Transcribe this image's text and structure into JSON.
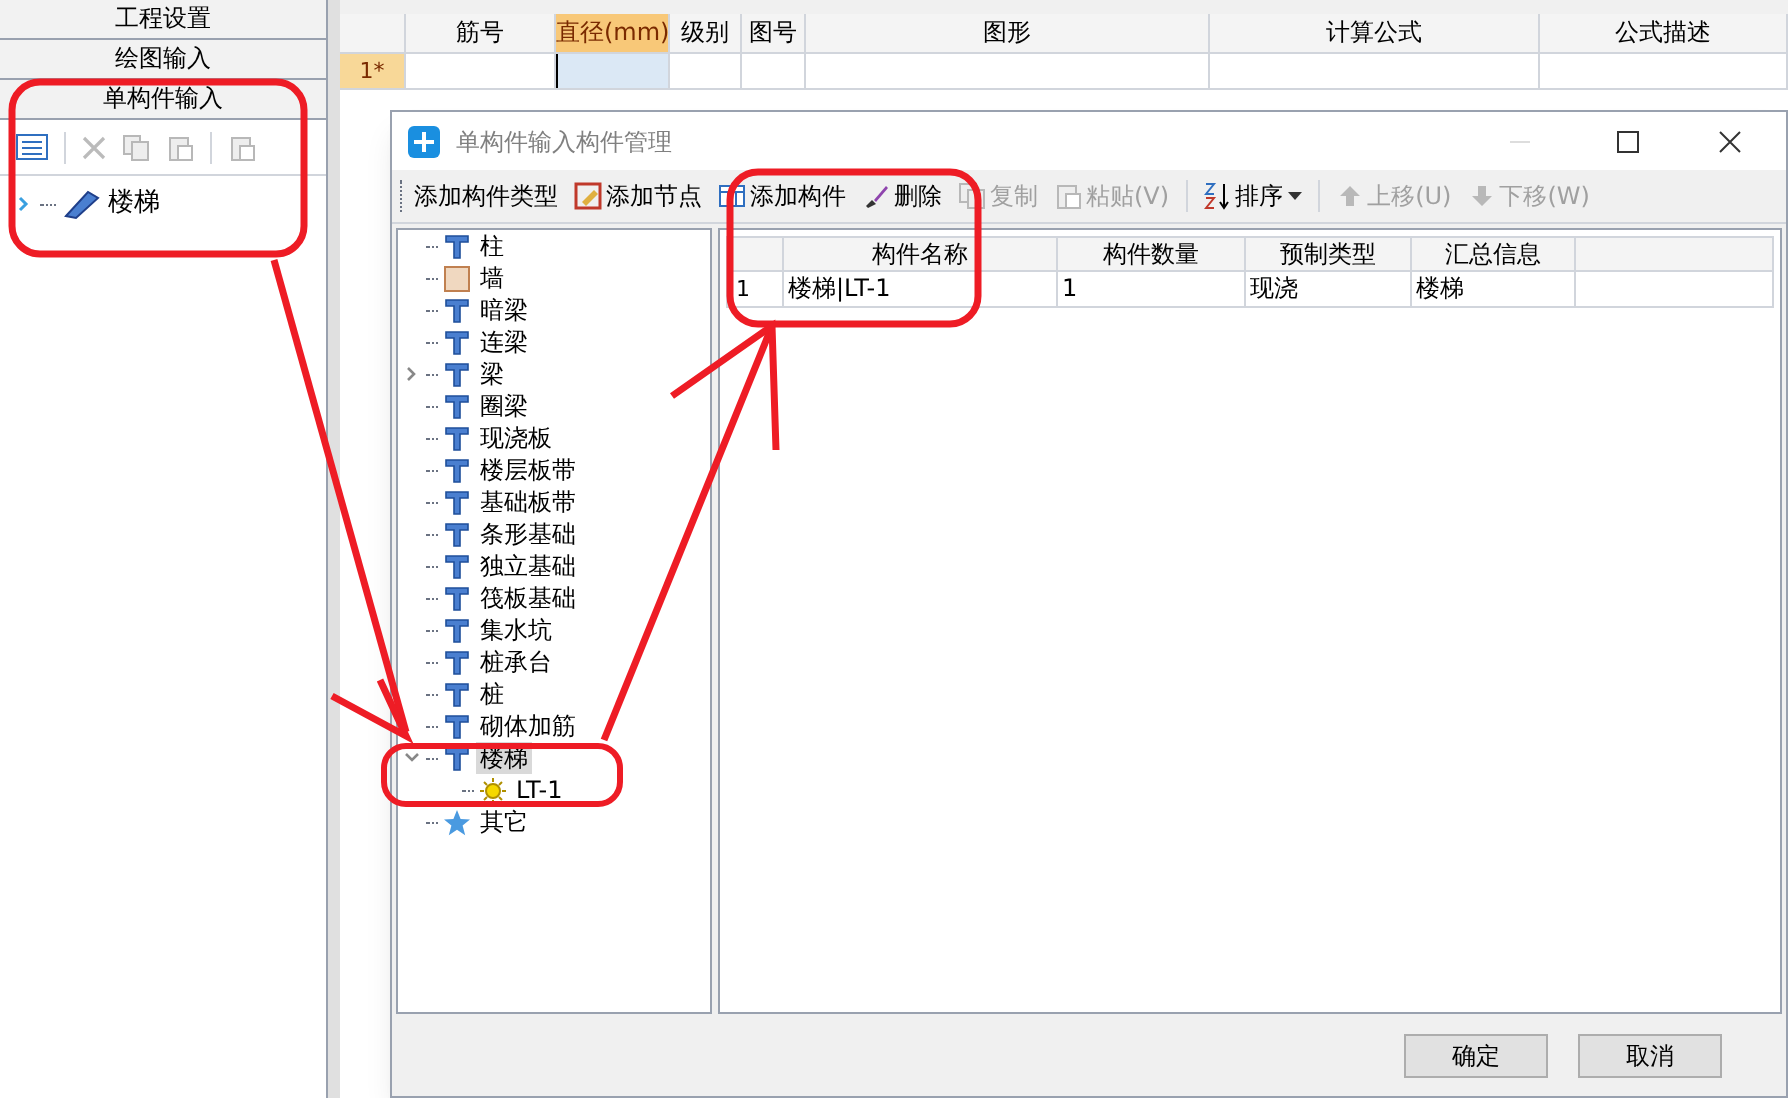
{
  "side_panel": {
    "tabs": [
      {
        "label": "工程设置"
      },
      {
        "label": "绘图输入"
      },
      {
        "label": "单构件输入"
      }
    ],
    "tree": [
      {
        "label": "楼梯",
        "expanded": false
      }
    ]
  },
  "rebar_table": {
    "columns": [
      {
        "label": "筋号",
        "selected": false
      },
      {
        "label": "直径(mm)",
        "selected": true
      },
      {
        "label": "级别",
        "selected": false
      },
      {
        "label": "图号",
        "selected": false
      },
      {
        "label": "图形",
        "selected": false
      },
      {
        "label": "计算公式",
        "selected": false
      },
      {
        "label": "公式描述",
        "selected": false
      }
    ],
    "rows": [
      {
        "label": "1*"
      }
    ]
  },
  "dialog": {
    "title": "单构件输入构件管理",
    "toolbar": [
      {
        "label": "添加构件类型",
        "kind": "none",
        "disabled": false
      },
      {
        "label": "添加节点",
        "kind": "add-node",
        "disabled": false
      },
      {
        "label": "添加构件",
        "kind": "add-item",
        "disabled": false
      },
      {
        "label": "删除",
        "kind": "delete",
        "disabled": false
      },
      {
        "label": "复制",
        "kind": "copy",
        "disabled": true
      },
      {
        "label": "粘贴(V)",
        "kind": "paste",
        "disabled": true
      },
      {
        "label": "排序",
        "kind": "sort",
        "disabled": false
      },
      {
        "label": "上移(U)",
        "kind": "up",
        "disabled": true
      },
      {
        "label": "下移(W)",
        "kind": "down",
        "disabled": true
      }
    ],
    "tree": [
      {
        "label": "柱",
        "kind": "component",
        "selected": false
      },
      {
        "label": "墙",
        "kind": "wall",
        "selected": false
      },
      {
        "label": "暗梁",
        "kind": "component",
        "selected": false
      },
      {
        "label": "连梁",
        "kind": "component",
        "selected": false
      },
      {
        "label": "梁",
        "kind": "component",
        "selected": false,
        "expanded": false
      },
      {
        "label": "圈梁",
        "kind": "component",
        "selected": false
      },
      {
        "label": "现浇板",
        "kind": "component",
        "selected": false
      },
      {
        "label": "楼层板带",
        "kind": "component",
        "selected": false
      },
      {
        "label": "基础板带",
        "kind": "component",
        "selected": false
      },
      {
        "label": "条形基础",
        "kind": "component",
        "selected": false
      },
      {
        "label": "独立基础",
        "kind": "component",
        "selected": false
      },
      {
        "label": "筏板基础",
        "kind": "component",
        "selected": false
      },
      {
        "label": "集水坑",
        "kind": "component",
        "selected": false
      },
      {
        "label": "桩承台",
        "kind": "component",
        "selected": false
      },
      {
        "label": "桩",
        "kind": "component",
        "selected": false
      },
      {
        "label": "砌体加筋",
        "kind": "component",
        "selected": false
      },
      {
        "label": "楼梯",
        "kind": "component",
        "selected": true,
        "expanded": true,
        "children": [
          {
            "label": "LT-1",
            "kind": "part",
            "selected": false
          }
        ]
      },
      {
        "label": "其它",
        "kind": "star",
        "selected": false
      }
    ],
    "table": {
      "columns": [
        "构件名称",
        "构件数量",
        "预制类型",
        "汇总信息"
      ],
      "rows": [
        {
          "index": "1",
          "cells": [
            "楼梯|LT-1",
            "1",
            "现浇",
            "楼梯"
          ]
        }
      ]
    },
    "buttons": [
      {
        "label": "确定"
      },
      {
        "label": "取消"
      }
    ]
  }
}
